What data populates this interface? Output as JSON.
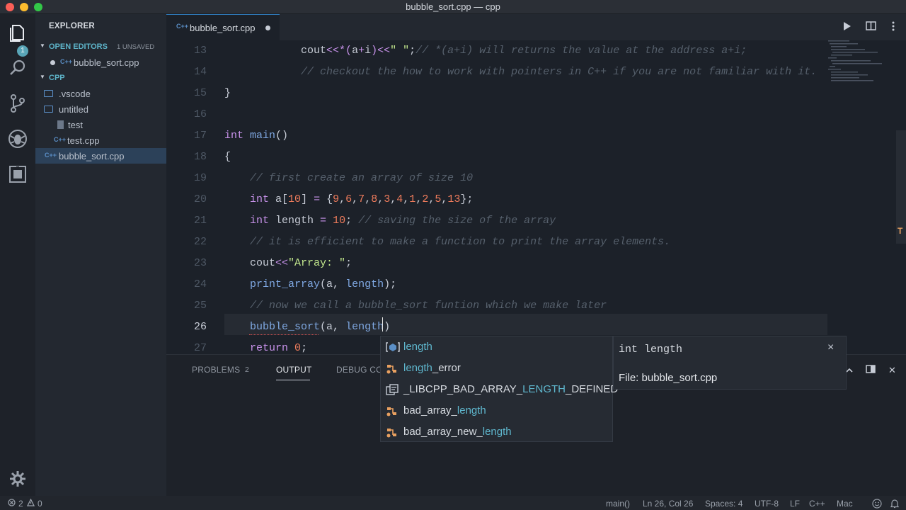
{
  "window": {
    "title": "bubble_sort.cpp — cpp"
  },
  "activity": {
    "explorer_badge": "1"
  },
  "sidebar": {
    "title": "EXPLORER",
    "open_editors": {
      "label": "OPEN EDITORS",
      "unsaved": "1 UNSAVED",
      "files": [
        "bubble_sort.cpp"
      ]
    },
    "folder": {
      "label": "CPP",
      "items": [
        ".vscode",
        "untitled",
        "test",
        "test.cpp",
        "bubble_sort.cpp"
      ]
    },
    "cpp_icon_glyph": "C++"
  },
  "tabs": [
    {
      "label": "bubble_sort.cpp",
      "dirty": true
    }
  ],
  "editor": {
    "cursor_line": "26",
    "lines": [
      {
        "num": "13",
        "parts": [
          {
            "t": "            ",
            "c": "plain"
          },
          {
            "t": "cout",
            "c": "plain"
          },
          {
            "t": "<<*(",
            "c": "kw"
          },
          {
            "t": "a",
            "c": "plain"
          },
          {
            "t": "+",
            "c": "kw"
          },
          {
            "t": "i",
            "c": "plain"
          },
          {
            "t": ")<<",
            "c": "kw"
          },
          {
            "t": "\" \"",
            "c": "str"
          },
          {
            "t": ";",
            "c": "plain"
          },
          {
            "t": "// *(a+i) will returns the value at the address a+i;",
            "c": "cmt"
          }
        ]
      },
      {
        "num": "14",
        "parts": [
          {
            "t": "            ",
            "c": "plain"
          },
          {
            "t": "// checkout the how to work with pointers in C++ if you are not familiar with it.",
            "c": "cmt"
          }
        ]
      },
      {
        "num": "15",
        "parts": [
          {
            "t": "}",
            "c": "plain"
          }
        ]
      },
      {
        "num": "16",
        "parts": []
      },
      {
        "num": "17",
        "parts": [
          {
            "t": "int",
            "c": "kw"
          },
          {
            "t": " ",
            "c": "plain"
          },
          {
            "t": "main",
            "c": "fn"
          },
          {
            "t": "()",
            "c": "plain"
          }
        ]
      },
      {
        "num": "18",
        "parts": [
          {
            "t": "{",
            "c": "plain"
          }
        ]
      },
      {
        "num": "19",
        "parts": [
          {
            "t": "    ",
            "c": "plain"
          },
          {
            "t": "// first create an array of size 10",
            "c": "cmt"
          }
        ]
      },
      {
        "num": "20",
        "parts": [
          {
            "t": "    ",
            "c": "plain"
          },
          {
            "t": "int",
            "c": "kw"
          },
          {
            "t": " a[",
            "c": "plain"
          },
          {
            "t": "10",
            "c": "num"
          },
          {
            "t": "] ",
            "c": "plain"
          },
          {
            "t": "=",
            "c": "kw"
          },
          {
            "t": " {",
            "c": "plain"
          },
          {
            "t": "9",
            "c": "num"
          },
          {
            "t": ",",
            "c": "plain"
          },
          {
            "t": "6",
            "c": "num"
          },
          {
            "t": ",",
            "c": "plain"
          },
          {
            "t": "7",
            "c": "num"
          },
          {
            "t": ",",
            "c": "plain"
          },
          {
            "t": "8",
            "c": "num"
          },
          {
            "t": ",",
            "c": "plain"
          },
          {
            "t": "3",
            "c": "num"
          },
          {
            "t": ",",
            "c": "plain"
          },
          {
            "t": "4",
            "c": "num"
          },
          {
            "t": ",",
            "c": "plain"
          },
          {
            "t": "1",
            "c": "num"
          },
          {
            "t": ",",
            "c": "plain"
          },
          {
            "t": "2",
            "c": "num"
          },
          {
            "t": ",",
            "c": "plain"
          },
          {
            "t": "5",
            "c": "num"
          },
          {
            "t": ",",
            "c": "plain"
          },
          {
            "t": "13",
            "c": "num"
          },
          {
            "t": "};",
            "c": "plain"
          }
        ]
      },
      {
        "num": "21",
        "parts": [
          {
            "t": "    ",
            "c": "plain"
          },
          {
            "t": "int",
            "c": "kw"
          },
          {
            "t": " length ",
            "c": "plain"
          },
          {
            "t": "=",
            "c": "kw"
          },
          {
            "t": " ",
            "c": "plain"
          },
          {
            "t": "10",
            "c": "num"
          },
          {
            "t": "; ",
            "c": "plain"
          },
          {
            "t": "// saving the size of the array",
            "c": "cmt"
          }
        ]
      },
      {
        "num": "22",
        "parts": [
          {
            "t": "    ",
            "c": "plain"
          },
          {
            "t": "// it is efficient to make a function to print the array elements.",
            "c": "cmt"
          }
        ]
      },
      {
        "num": "23",
        "parts": [
          {
            "t": "    ",
            "c": "plain"
          },
          {
            "t": "cout",
            "c": "plain"
          },
          {
            "t": "<<",
            "c": "kw"
          },
          {
            "t": "\"Array: \"",
            "c": "str"
          },
          {
            "t": ";",
            "c": "plain"
          }
        ]
      },
      {
        "num": "24",
        "parts": [
          {
            "t": "    ",
            "c": "plain"
          },
          {
            "t": "print_array",
            "c": "fn"
          },
          {
            "t": "(a, ",
            "c": "plain"
          },
          {
            "t": "length",
            "c": "fn"
          },
          {
            "t": ");",
            "c": "plain"
          }
        ]
      },
      {
        "num": "25",
        "parts": [
          {
            "t": "    ",
            "c": "plain"
          },
          {
            "t": "// now we call a bubble_sort funtion which we make later",
            "c": "cmt"
          }
        ]
      },
      {
        "num": "26",
        "parts": [
          {
            "t": "    ",
            "c": "plain"
          },
          {
            "t": "bubble_sort",
            "c": "fn"
          },
          {
            "t": "(a, ",
            "c": "plain"
          },
          {
            "t": "length",
            "c": "fn"
          },
          {
            "t": ")",
            "c": "plain"
          }
        ]
      },
      {
        "num": "27",
        "parts": [
          {
            "t": "    ",
            "c": "plain"
          },
          {
            "t": "return",
            "c": "kw"
          },
          {
            "t": " ",
            "c": "plain"
          },
          {
            "t": "0",
            "c": "num"
          },
          {
            "t": ";",
            "c": "plain"
          }
        ]
      }
    ]
  },
  "suggest": {
    "items": [
      {
        "pre": "",
        "hl": "length",
        "post": "",
        "icon": "[⊘]",
        "kind": "variable-icon"
      },
      {
        "pre": "",
        "hl": "length",
        "post": "_error",
        "icon": "class",
        "kind": "class-icon"
      },
      {
        "pre": "_LIBCPP_BAD_ARRAY_",
        "hl": "LENGTH",
        "post": "_DEFINED",
        "icon": "macro",
        "kind": "macro-icon"
      },
      {
        "pre": "bad_array_",
        "hl": "length",
        "post": "",
        "icon": "class",
        "kind": "class-icon"
      },
      {
        "pre": "bad_array_new_",
        "hl": "length",
        "post": "",
        "icon": "class",
        "kind": "class-icon"
      }
    ],
    "details": {
      "signature": "int length",
      "file": "File: bubble_sort.cpp",
      "close": "×"
    }
  },
  "panel": {
    "tabs": [
      "PROBLEMS",
      "OUTPUT",
      "DEBUG CO"
    ],
    "problems_count": "2",
    "close": "✕"
  },
  "status": {
    "errors": "2",
    "warnings": "0",
    "function": "main()",
    "position": "Ln 26, Col 26",
    "spaces": "Spaces: 4",
    "encoding": "UTF-8",
    "eol": "LF",
    "language": "C++",
    "platform": "Mac"
  },
  "colors": {
    "accent": "#5db3c8",
    "background": "#1c2129",
    "sidebar": "#232830"
  }
}
